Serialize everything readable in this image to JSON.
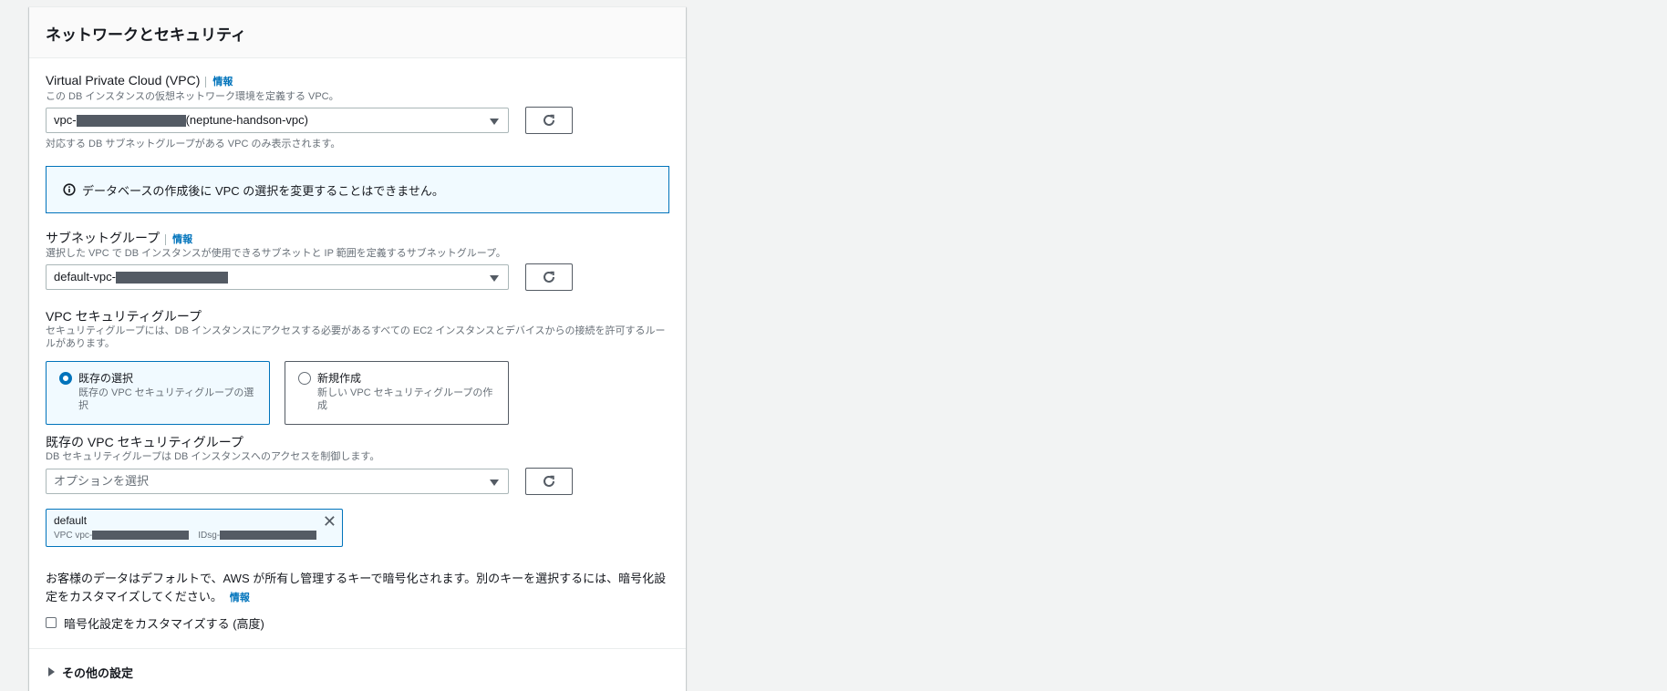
{
  "section": {
    "title": "ネットワークとセキュリティ"
  },
  "info_label": "情報",
  "vpc": {
    "label": "Virtual Private Cloud (VPC)",
    "description": "この DB インスタンスの仮想ネットワーク環境を定義する VPC。",
    "value_prefix": "vpc-",
    "value_suffix": "(neptune-handson-vpc)",
    "hint": "対応する DB サブネットグループがある VPC のみ表示されます。"
  },
  "alert": {
    "text": "データベースの作成後に VPC の選択を変更することはできません。"
  },
  "subnet_group": {
    "label": "サブネットグループ",
    "description": "選択した VPC で DB インスタンスが使用できるサブネットと IP 範囲を定義するサブネットグループ。",
    "value_prefix": "default-vpc-"
  },
  "security_group": {
    "label": "VPC セキュリティグループ",
    "description": "セキュリティグループには、DB インスタンスにアクセスする必要があるすべての EC2 インスタンスとデバイスからの接続を許可するルールがあります。",
    "options": [
      {
        "title": "既存の選択",
        "desc": "既存の VPC セキュリティグループの選択",
        "selected": true
      },
      {
        "title": "新規作成",
        "desc": "新しい VPC セキュリティグループの作成",
        "selected": false
      }
    ]
  },
  "existing_sg": {
    "label": "既存の VPC セキュリティグループ",
    "description": "DB セキュリティグループは DB インスタンスへのアクセスを制御します。",
    "placeholder": "オプションを選択",
    "token": {
      "label": "default",
      "vpc_prefix": "VPC vpc-",
      "id_prefix": "IDsg-"
    }
  },
  "encryption": {
    "text": "お客様のデータはデフォルトで、AWS が所有し管理するキーで暗号化されます。別のキーを選択するには、暗号化設定をカスタマイズしてください。",
    "checkbox_label": "暗号化設定をカスタマイズする (高度)"
  },
  "other_settings": {
    "label": "その他の設定"
  },
  "icons": {
    "refresh": "refresh-icon",
    "info": "info-circle-icon",
    "close": "close-icon",
    "caret": "caret-down-icon"
  },
  "colors": {
    "accent": "#0073bb",
    "alert_bg": "#f1faff",
    "page_bg": "#f2f3f3"
  }
}
